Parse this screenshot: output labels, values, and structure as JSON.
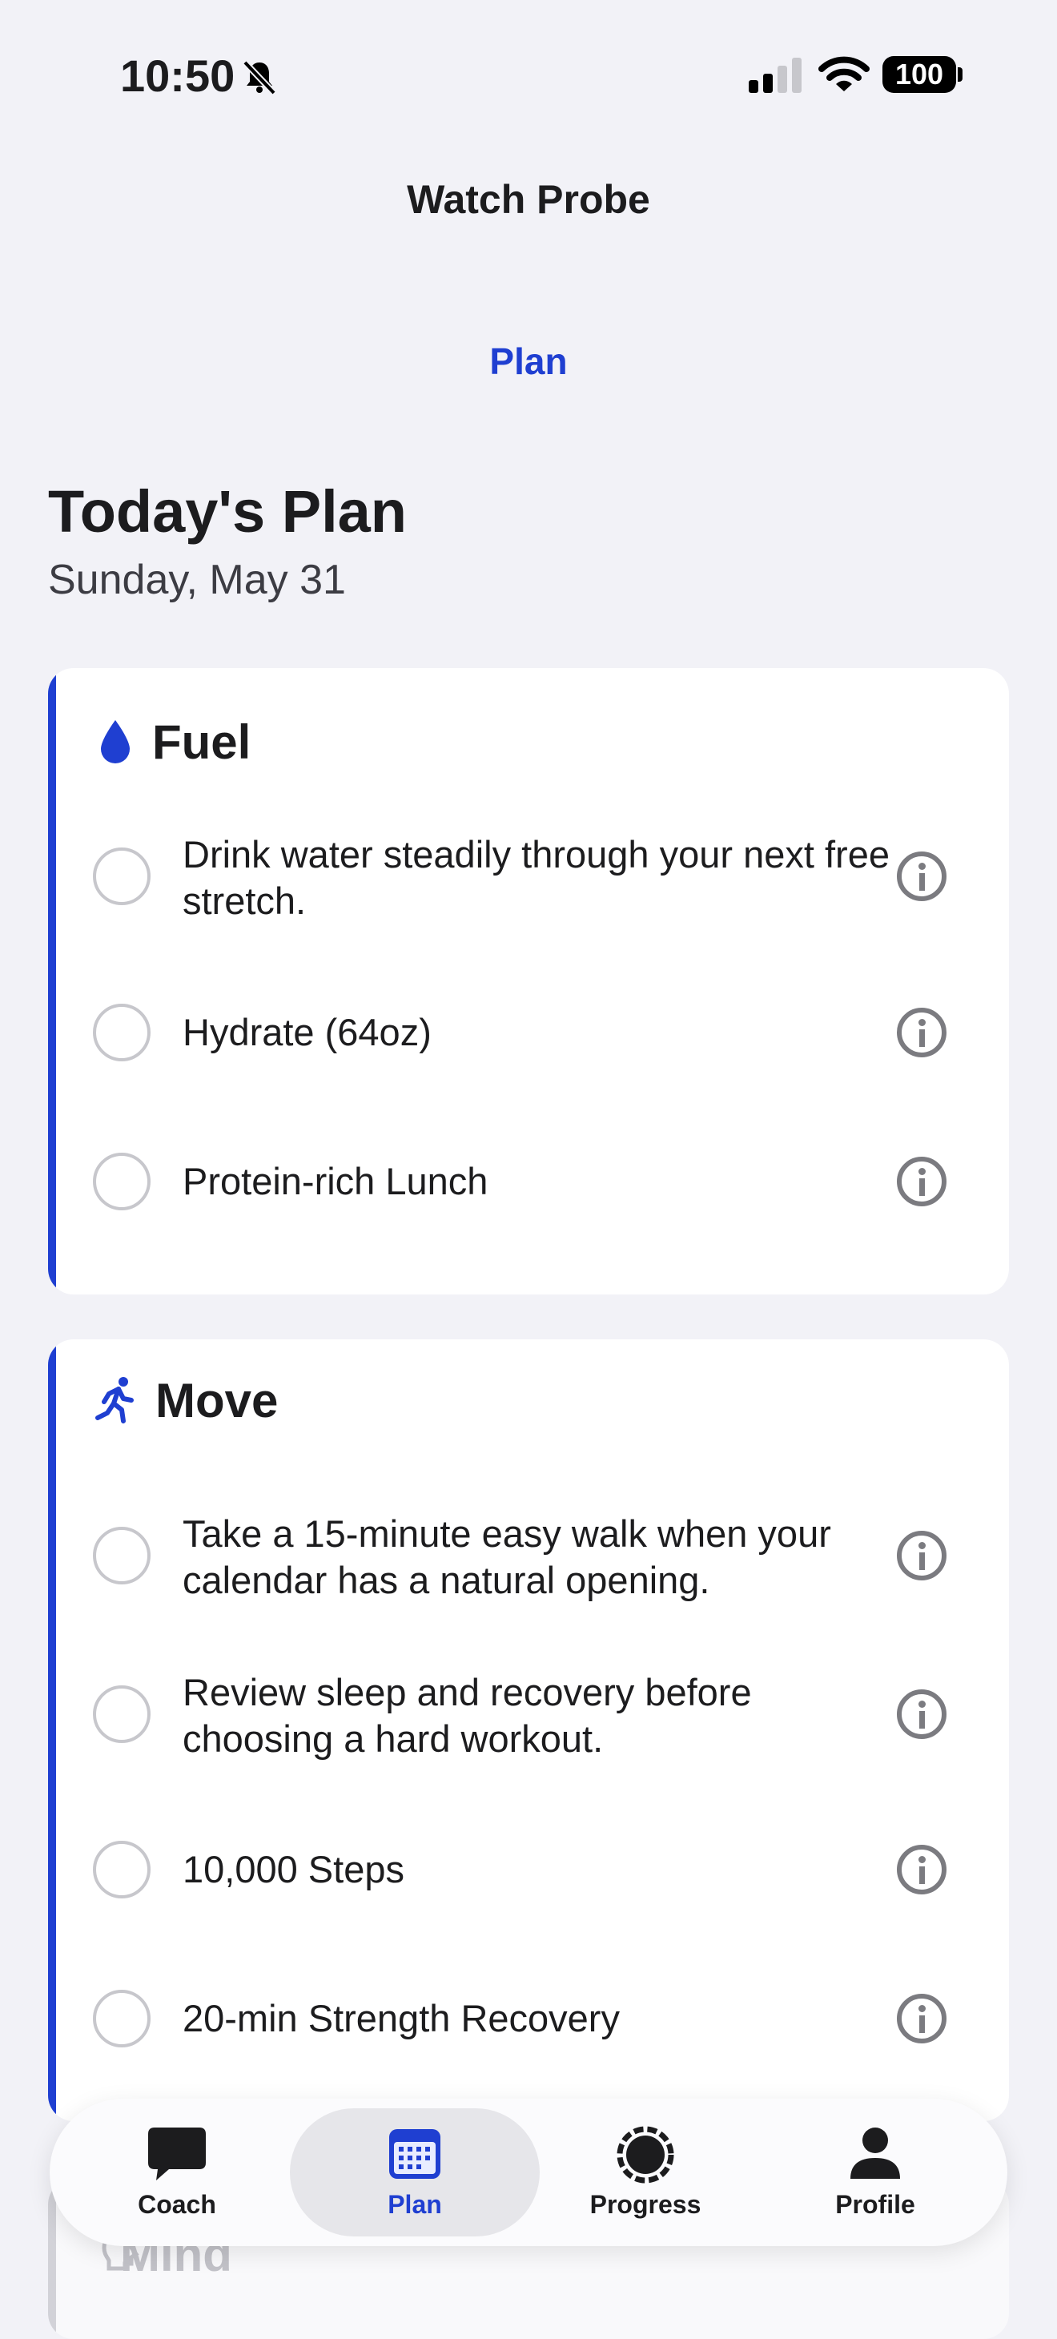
{
  "status_bar": {
    "time": "10:50",
    "battery": "100"
  },
  "header": {
    "app_title": "Watch Probe",
    "nav_title": "Plan"
  },
  "page": {
    "title": "Today's Plan",
    "date": "Sunday, May 31"
  },
  "sections": [
    {
      "label": "Fuel",
      "icon": "water-drop-icon",
      "items": [
        {
          "text": "Drink water steadily through your next free stretch."
        },
        {
          "text": "Hydrate (64oz)"
        },
        {
          "text": "Protein-rich Lunch"
        }
      ]
    },
    {
      "label": "Move",
      "icon": "running-figure-icon",
      "items": [
        {
          "text": "Take a 15-minute easy walk when your calendar has a natural opening."
        },
        {
          "text": "Review sleep and recovery before choosing a hard workout."
        },
        {
          "text": "10,000 Steps"
        },
        {
          "text": "20-min Strength Recovery"
        }
      ]
    },
    {
      "label": "Mind",
      "icon": "brain-icon"
    }
  ],
  "tab_bar": {
    "tabs": [
      {
        "label": "Coach",
        "icon": "chat-bubble-icon"
      },
      {
        "label": "Plan",
        "icon": "calendar-icon",
        "active": true
      },
      {
        "label": "Progress",
        "icon": "progress-ring-icon"
      },
      {
        "label": "Profile",
        "icon": "person-icon"
      }
    ]
  },
  "colors": {
    "accent": "#1f3fd1",
    "background": "#f2f2f7",
    "card": "#ffffff"
  }
}
